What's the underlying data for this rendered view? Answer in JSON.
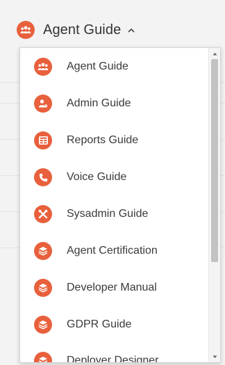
{
  "dropdown": {
    "selected_label": "Agent Guide",
    "accent_color": "#e8603c",
    "items": [
      {
        "label": "Agent Guide",
        "icon": "team-icon"
      },
      {
        "label": "Admin Guide",
        "icon": "admin-user-icon"
      },
      {
        "label": "Reports Guide",
        "icon": "report-grid-icon"
      },
      {
        "label": "Voice Guide",
        "icon": "phone-icon"
      },
      {
        "label": "Sysadmin Guide",
        "icon": "tools-icon"
      },
      {
        "label": "Agent Certification",
        "icon": "stack-icon"
      },
      {
        "label": "Developer Manual",
        "icon": "stack-icon"
      },
      {
        "label": "GDPR Guide",
        "icon": "stack-icon"
      },
      {
        "label": "Deployer Designer",
        "icon": "stack-icon"
      }
    ]
  }
}
